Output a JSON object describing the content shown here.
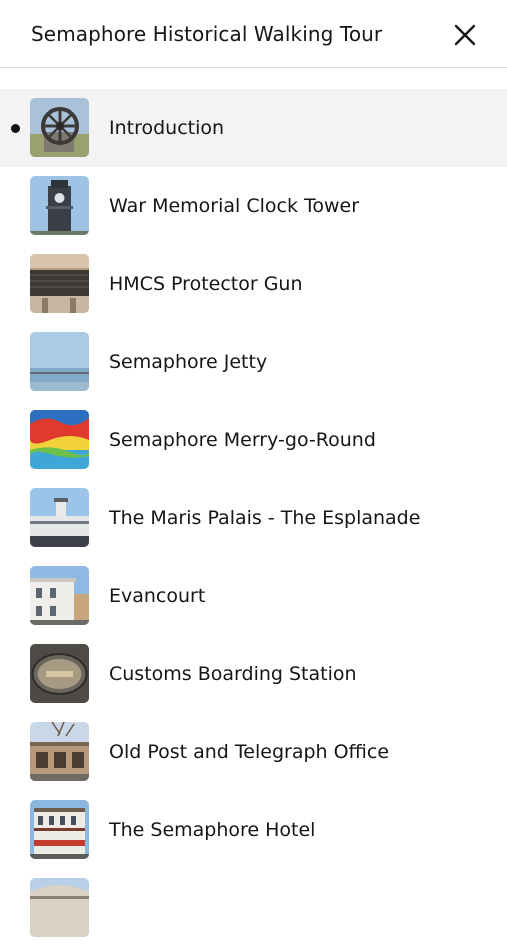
{
  "header": {
    "title": "Semaphore Historical Walking Tour",
    "close_icon": "close-icon"
  },
  "stops": [
    {
      "label": "Introduction",
      "active": true,
      "thumb": "anchor-wheel"
    },
    {
      "label": "War Memorial Clock Tower",
      "active": false,
      "thumb": "clock-tower"
    },
    {
      "label": "HMCS Protector Gun",
      "active": false,
      "thumb": "gun"
    },
    {
      "label": "Semaphore Jetty",
      "active": false,
      "thumb": "jetty"
    },
    {
      "label": "Semaphore Merry-go-Round",
      "active": false,
      "thumb": "merry-go-round"
    },
    {
      "label": "The Maris Palais - The Esplanade",
      "active": false,
      "thumb": "maris-palais"
    },
    {
      "label": "Evancourt",
      "active": false,
      "thumb": "evancourt"
    },
    {
      "label": "Customs Boarding Station",
      "active": false,
      "thumb": "customs-plaque"
    },
    {
      "label": "Old Post and Telegraph Office",
      "active": false,
      "thumb": "post-office"
    },
    {
      "label": "The Semaphore Hotel",
      "active": false,
      "thumb": "hotel"
    },
    {
      "label": "",
      "active": false,
      "thumb": "building-partial"
    }
  ]
}
